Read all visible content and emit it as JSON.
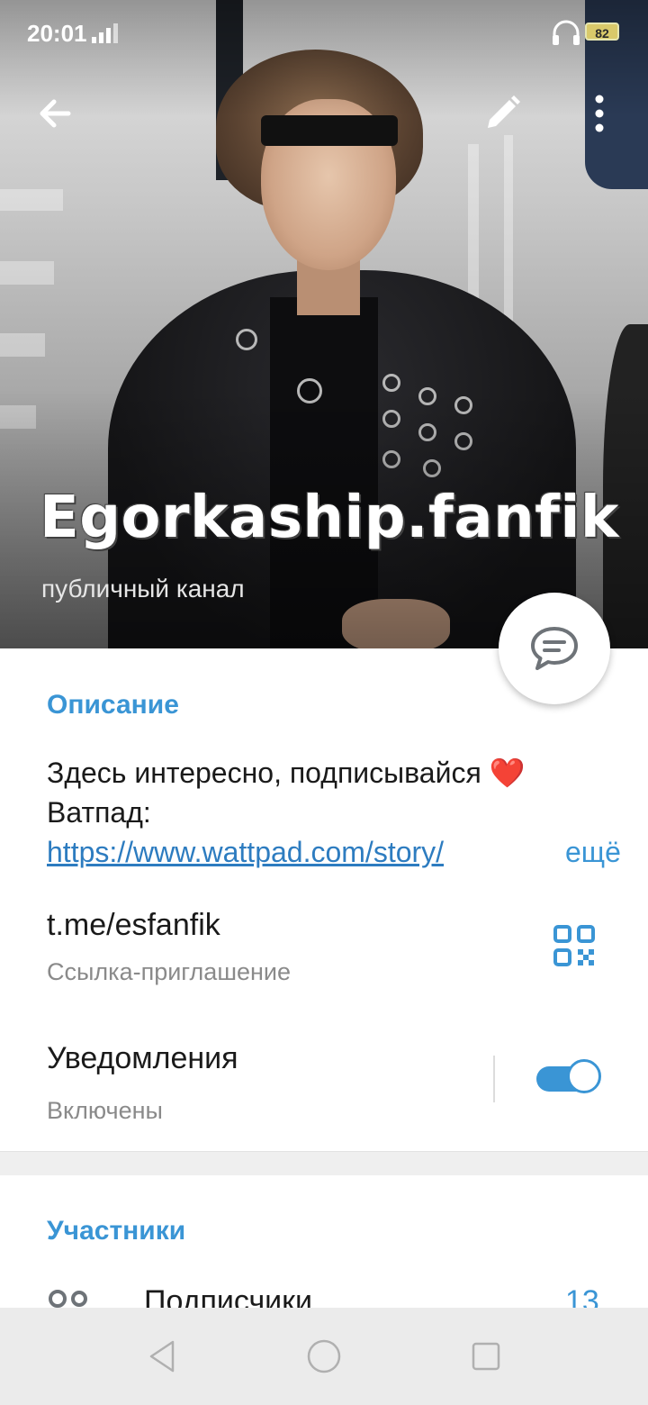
{
  "status_bar": {
    "time": "20:01",
    "battery": "82",
    "icons": [
      "signal-icon",
      "headset-icon",
      "battery-icon"
    ]
  },
  "toolbar": {
    "icons": [
      "back-arrow-icon",
      "pencil-icon",
      "more-vertical-icon"
    ]
  },
  "channel": {
    "name": "Egorkaship.fanfik",
    "type": "публичный канал"
  },
  "fab": {
    "icon": "message-bubble-icon"
  },
  "description": {
    "heading": "Описание",
    "line1": "Здесь интересно, подписывайся ❤️",
    "line2": "Ватпад:",
    "link": "https://www.wattpad.com/story/",
    "more": "ещё"
  },
  "link_row": {
    "value": "t.me/esfanfik",
    "caption": "Ссылка-приглашение",
    "icon": "qr-code-icon"
  },
  "notifications": {
    "label": "Уведомления",
    "state": "Включены",
    "enabled": true
  },
  "members": {
    "heading": "Участники",
    "subscribers_label": "Подписчики",
    "subscribers_count": "13",
    "icon": "users-icon"
  },
  "colors": {
    "accent": "#3a95d5",
    "link": "#2d7cc0",
    "secondary_text": "#8a8a8a"
  },
  "nav_bar": {
    "icons": [
      "nav-back-icon",
      "nav-home-icon",
      "nav-recents-icon"
    ]
  }
}
